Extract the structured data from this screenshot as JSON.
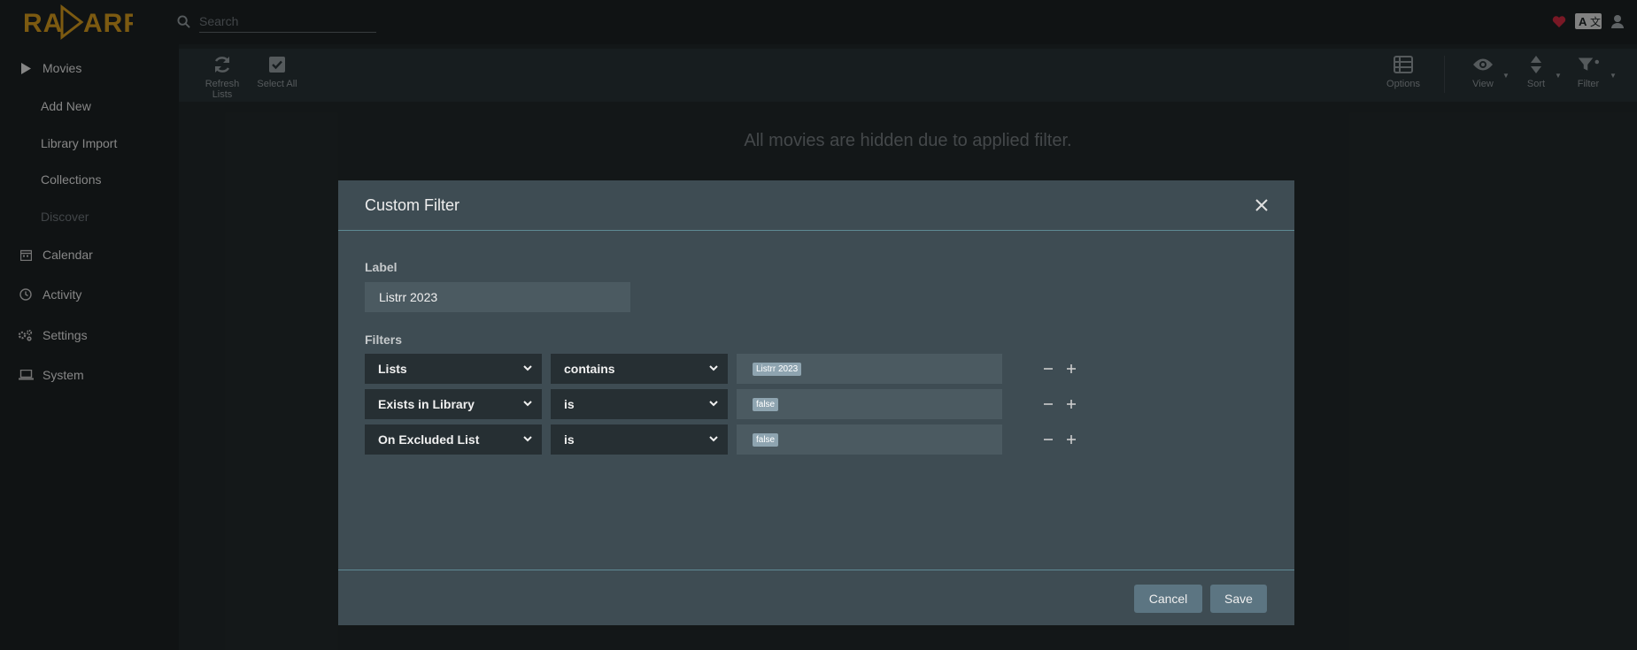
{
  "app": {
    "name": "Radarr",
    "search_placeholder": "Search"
  },
  "sidebar": {
    "movies": "Movies",
    "sub_items": [
      "Add New",
      "Library Import",
      "Collections",
      "Discover"
    ],
    "calendar": "Calendar",
    "activity": "Activity",
    "settings": "Settings",
    "system": "System"
  },
  "toolbar": {
    "refresh": "Refresh Lists",
    "select_all": "Select All",
    "options": "Options",
    "view": "View",
    "sort": "Sort",
    "filter": "Filter"
  },
  "content": {
    "message": "All movies are hidden due to applied filter."
  },
  "modal": {
    "title": "Custom Filter",
    "label_heading": "Label",
    "label_value": "Listrr 2023",
    "filters_heading": "Filters",
    "filters": [
      {
        "field": "Lists",
        "operator": "contains",
        "value": "Listrr 2023"
      },
      {
        "field": "Exists in Library",
        "operator": "is",
        "value": "false"
      },
      {
        "field": "On Excluded List",
        "operator": "is",
        "value": "false"
      }
    ],
    "cancel": "Cancel",
    "save": "Save"
  },
  "colors": {
    "brand": "#e5a00d",
    "heart": "#c4273c",
    "button": "#5c7582",
    "modal_bg": "#3e4c53"
  }
}
